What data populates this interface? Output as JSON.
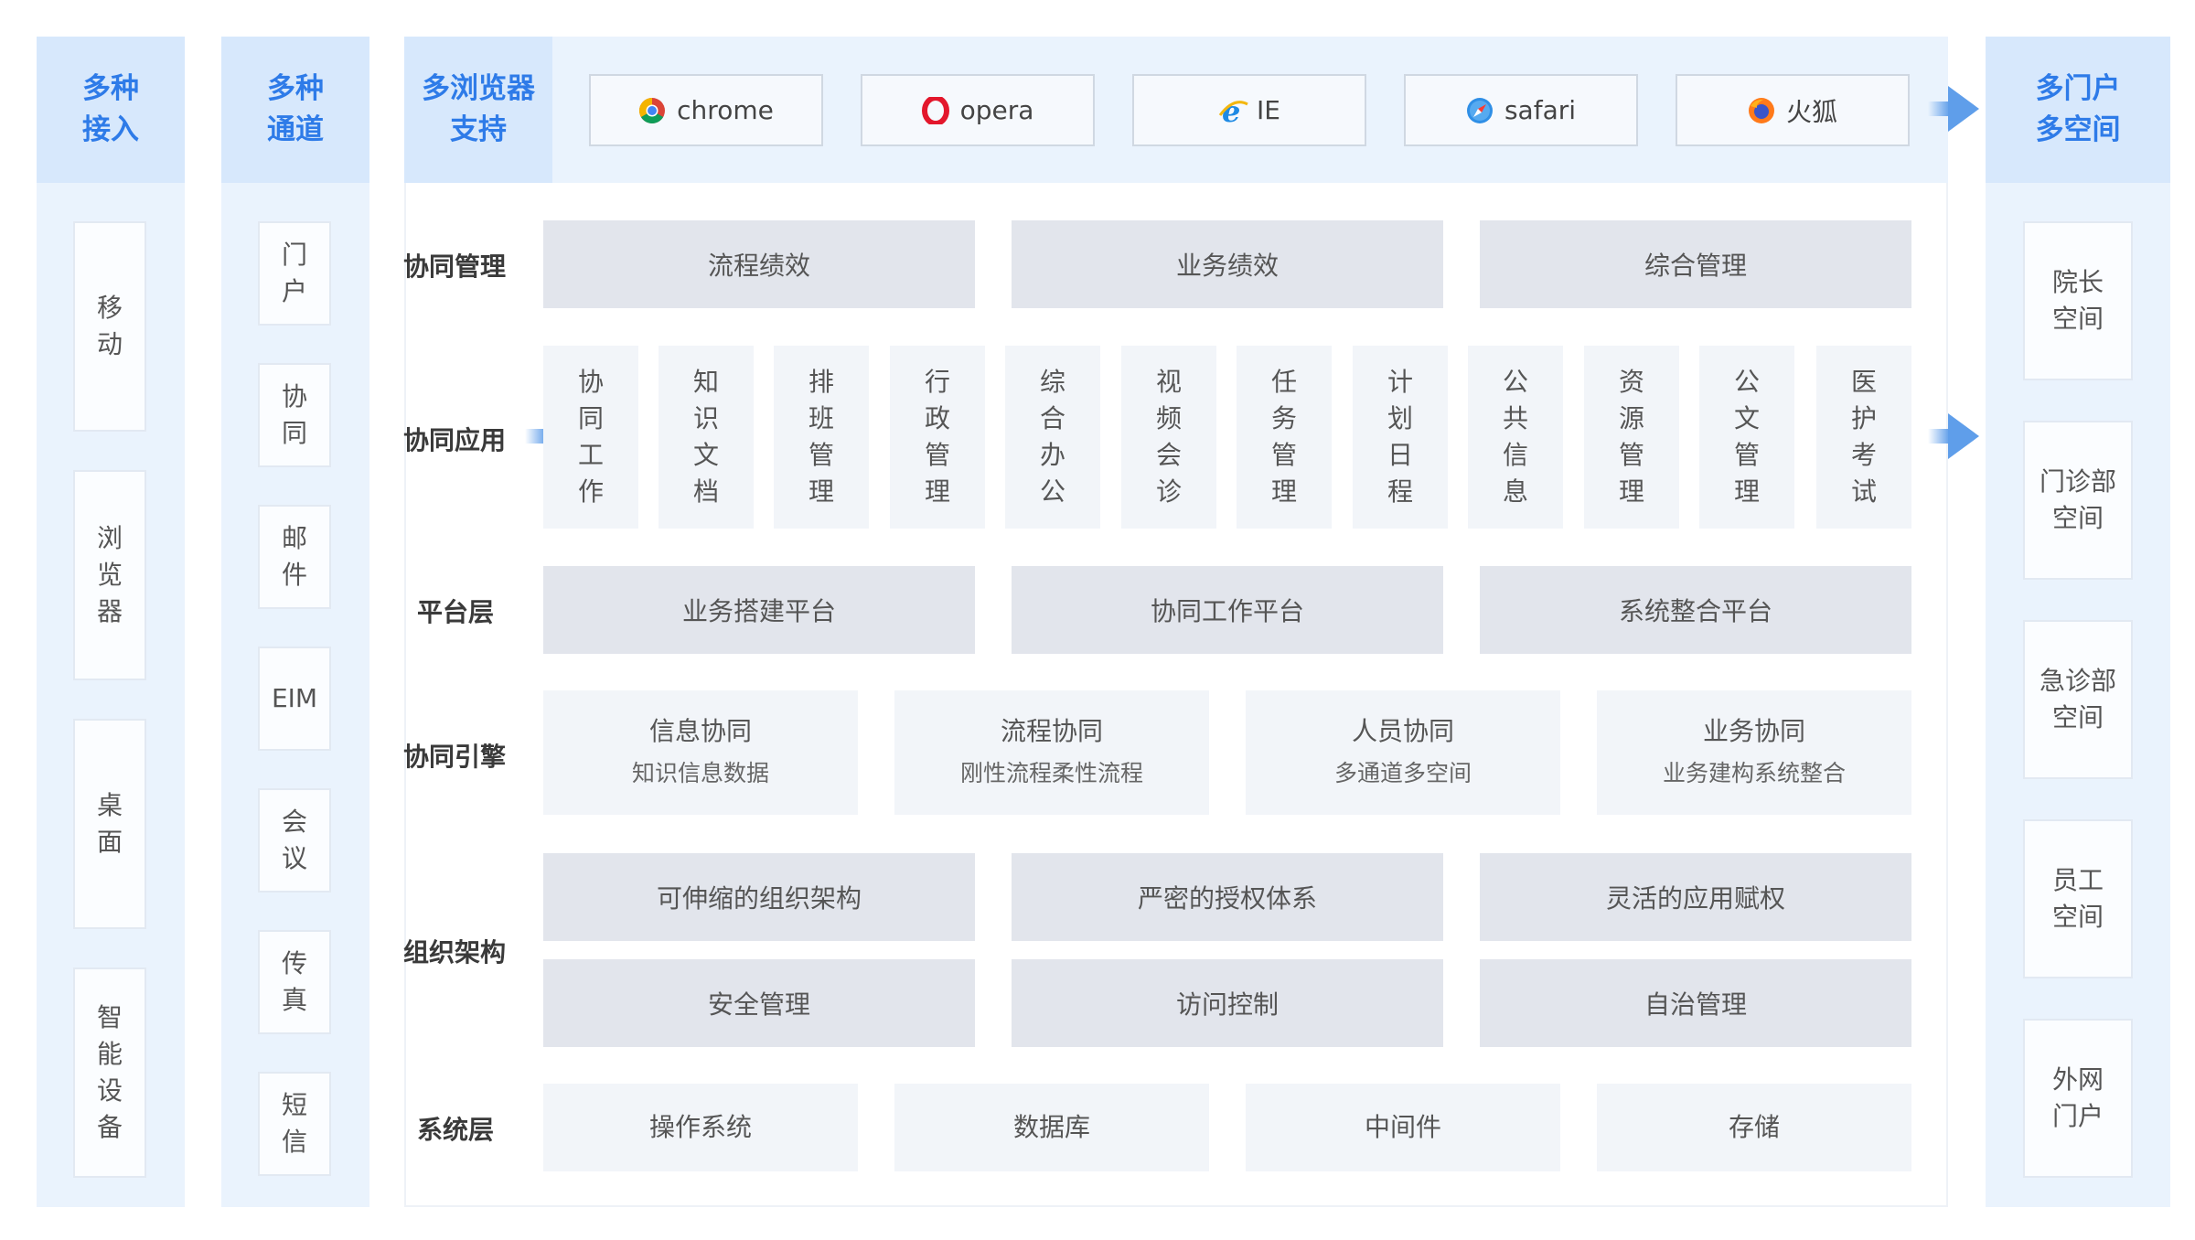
{
  "col1": {
    "title": "多种\n接入",
    "items": [
      "移动",
      "浏览器",
      "桌面",
      "智能设备"
    ]
  },
  "col2": {
    "title": "多种\n通道",
    "items": [
      "门户",
      "协同",
      "邮件",
      "EIM",
      "会议",
      "传真",
      "短信"
    ]
  },
  "browsers": {
    "title": "多浏览器\n支持",
    "items": [
      {
        "label": "chrome",
        "icon": "chrome-icon"
      },
      {
        "label": "opera",
        "icon": "opera-icon"
      },
      {
        "label": "IE",
        "icon": "ie-icon"
      },
      {
        "label": "safari",
        "icon": "safari-icon"
      },
      {
        "label": "火狐",
        "icon": "firefox-icon"
      }
    ]
  },
  "rows": {
    "mgmt": {
      "label": "协同管理",
      "items": [
        "流程绩效",
        "业务绩效",
        "综合管理"
      ]
    },
    "apps": {
      "label": "协同应用",
      "items": [
        "协同工作",
        "知识文档",
        "排班管理",
        "行政管理",
        "综合办公",
        "视频会诊",
        "任务管理",
        "计划日程",
        "公共信息",
        "资源管理",
        "公文管理",
        "医护考试"
      ]
    },
    "platform": {
      "label": "平台层",
      "items": [
        "业务搭建平台",
        "协同工作平台",
        "系统整合平台"
      ]
    },
    "engine": {
      "label": "协同引擎",
      "items": [
        {
          "title": "信息协同",
          "sub": "知识信息数据"
        },
        {
          "title": "流程协同",
          "sub": "刚性流程柔性流程"
        },
        {
          "title": "人员协同",
          "sub": "多通道多空间"
        },
        {
          "title": "业务协同",
          "sub": "业务建构系统整合"
        }
      ]
    },
    "org": {
      "label": "组织架构",
      "items": [
        "可伸缩的组织架构",
        "严密的授权体系",
        "灵活的应用赋权",
        "安全管理",
        "访问控制",
        "自治管理"
      ]
    },
    "system": {
      "label": "系统层",
      "items": [
        "操作系统",
        "数据库",
        "中间件",
        "存储"
      ]
    }
  },
  "col4": {
    "title": "多门户\n多空间",
    "items": [
      "院长\n空间",
      "门诊部\n空间",
      "急诊部\n空间",
      "员工\n空间",
      "外网\n门户"
    ]
  },
  "colors": {
    "accent": "#2e7be8",
    "header_bg": "#d7e8fc",
    "column_bg": "#eaf3fd",
    "box_gray": "#e2e5ec",
    "box_light": "#f2f5f9"
  }
}
